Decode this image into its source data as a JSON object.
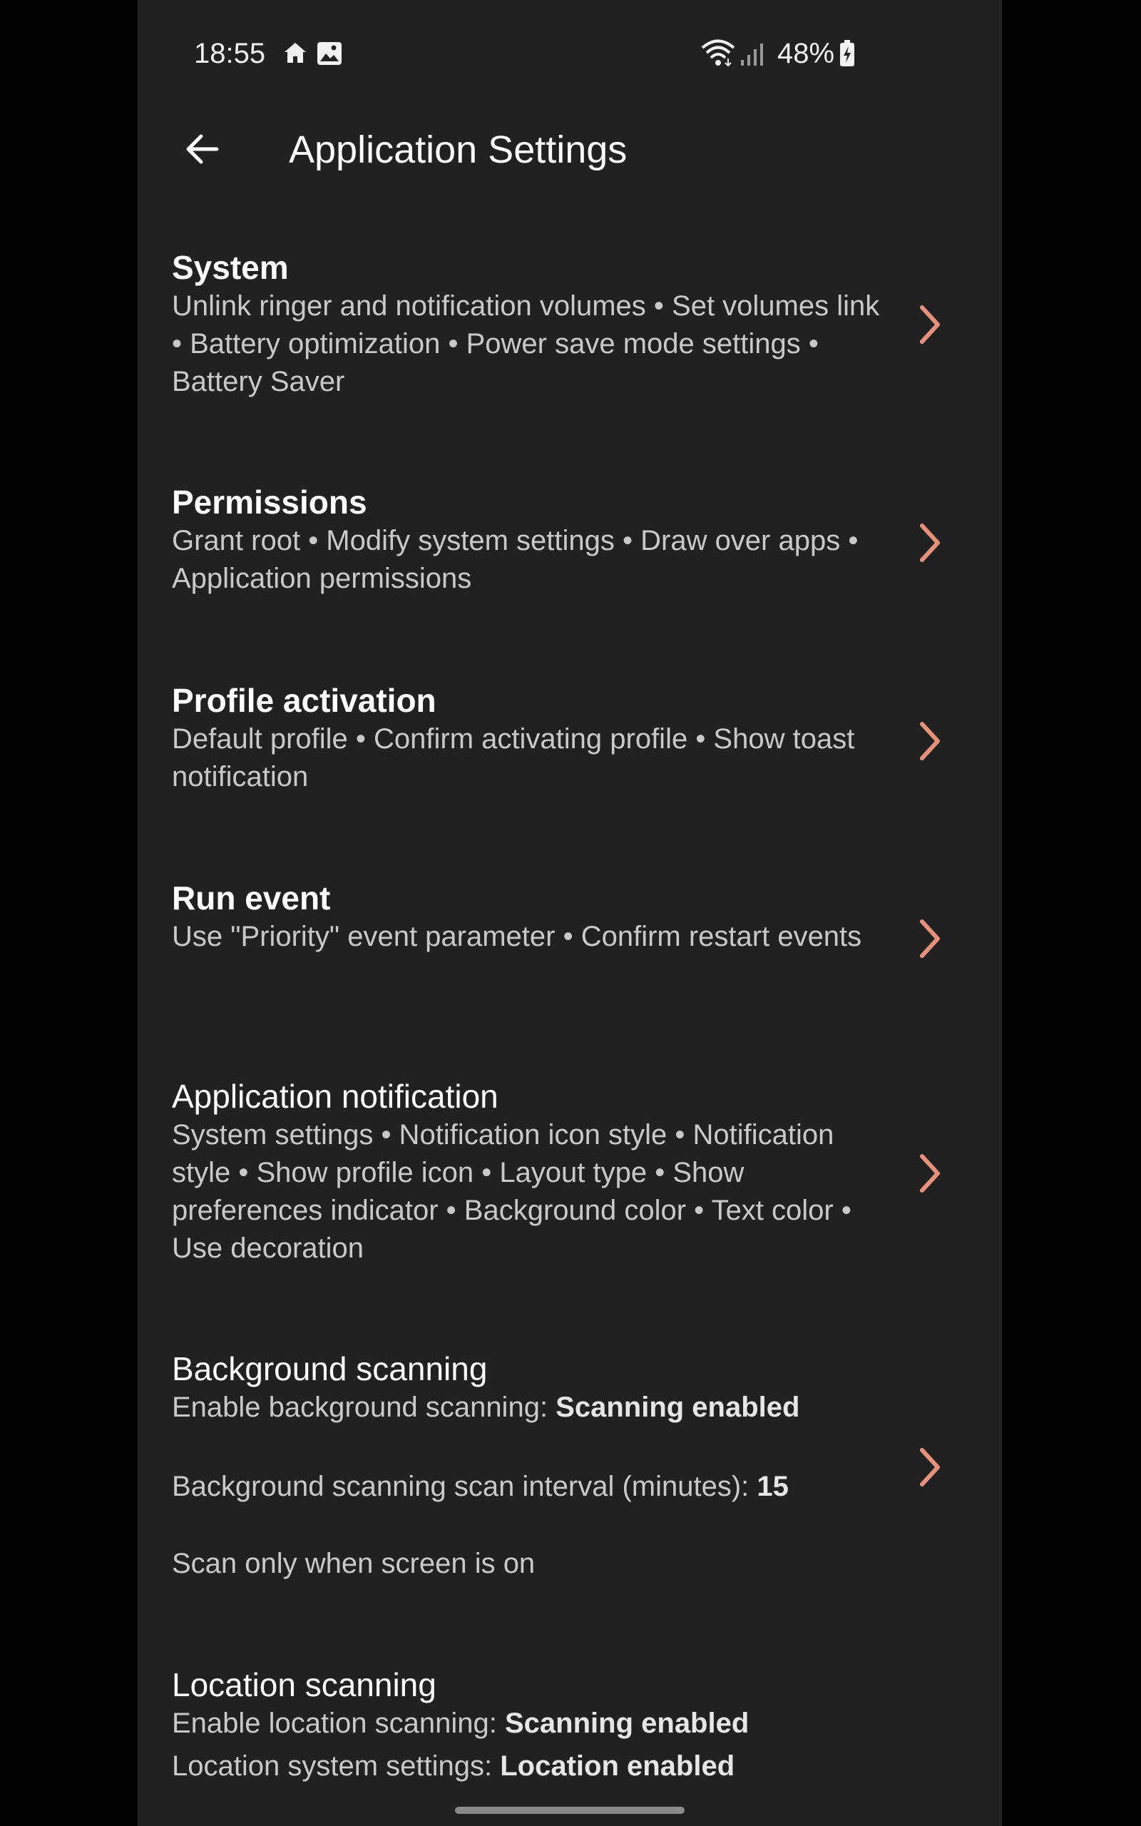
{
  "status_bar": {
    "time": "18:55",
    "icons": [
      "home-icon",
      "image-icon",
      "wifi-icon",
      "signal-icon",
      "battery-charging-icon"
    ],
    "battery": "48%"
  },
  "app_bar": {
    "title": "Application Settings",
    "back_icon": "arrow-back-icon"
  },
  "accent_color": "#e8907a",
  "preferences": [
    {
      "title": "System",
      "summary": "Unlink ringer and notification volumes • Set volumes link • Battery optimization • Power save mode settings • Battery Saver"
    },
    {
      "title": "Permissions",
      "summary": "Grant root • Modify system settings • Draw over apps • Application permissions"
    },
    {
      "title": "Profile activation",
      "summary": "Default profile • Confirm activating profile • Show toast notification"
    },
    {
      "title": "Run event",
      "summary": "Use \"Priority\" event parameter • Confirm restart events"
    },
    {
      "title": "Application notification",
      "summary": "System settings • Notification icon style • Notification style • Show profile icon • Layout type • Show preferences indicator • Background color • Text color • Use decoration"
    },
    {
      "title": "Background scanning",
      "lines": [
        {
          "label": "Enable background scanning: ",
          "value": "Scanning enabled"
        },
        {
          "label": "Background scanning scan interval (minutes): ",
          "value": "15"
        },
        {
          "label": "Scan only when screen is on",
          "value": ""
        }
      ]
    },
    {
      "title": "Location scanning",
      "lines": [
        {
          "label": "Enable location scanning: ",
          "value": "Scanning enabled"
        },
        {
          "label": "Location system settings: ",
          "value": "Location enabled"
        }
      ]
    }
  ]
}
